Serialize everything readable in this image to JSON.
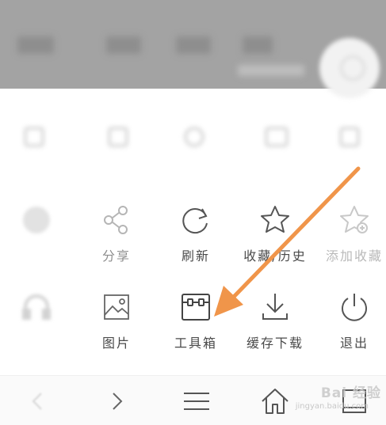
{
  "menu": {
    "row1": [
      {
        "icon": "settings-icon",
        "label": ""
      },
      {
        "icon": "share-icon",
        "label": "分享"
      },
      {
        "icon": "refresh-icon",
        "label": "刷新"
      },
      {
        "icon": "star-icon",
        "label": "收藏/历史"
      },
      {
        "icon": "add-bookmark-icon",
        "label": "添加收藏"
      }
    ],
    "row2": [
      {
        "icon": "headphones-icon",
        "label": ""
      },
      {
        "icon": "image-icon",
        "label": "图片"
      },
      {
        "icon": "toolbox-icon",
        "label": "工具箱"
      },
      {
        "icon": "download-icon",
        "label": "缓存下载"
      },
      {
        "icon": "power-icon",
        "label": "退出"
      }
    ]
  },
  "bottom_nav": {
    "items": [
      "back-icon",
      "forward-icon",
      "menu-icon",
      "home-icon",
      "tabs-icon"
    ]
  },
  "watermark": {
    "brand": "Bai 经验",
    "url": "jingyan.baidu.com"
  },
  "colors": {
    "accent_arrow": "#f0954a",
    "label": "#4a4a4a",
    "topbar": "#a3a3a3"
  }
}
